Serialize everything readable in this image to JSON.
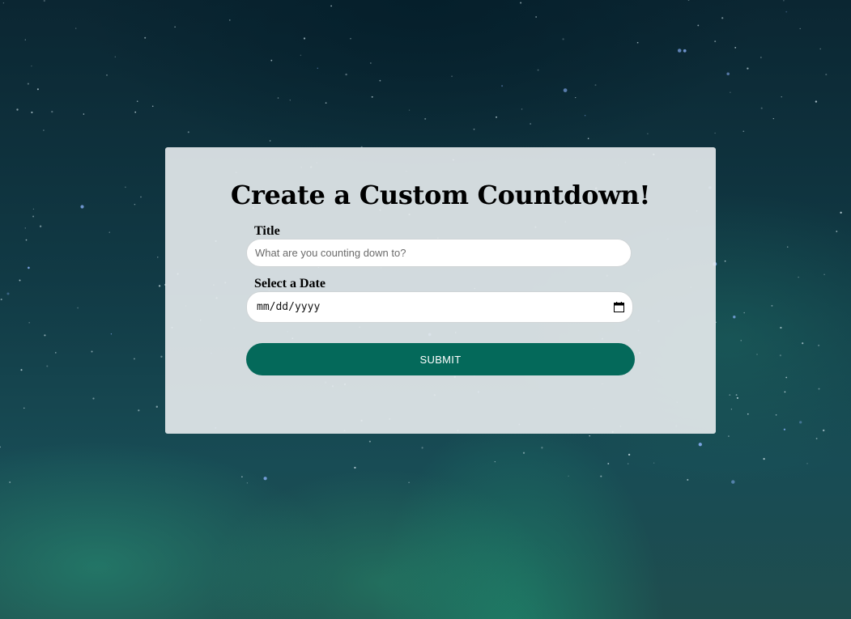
{
  "background": {
    "description_colors": {
      "sky_dark": "#0b2632",
      "aurora": "#1ea078"
    }
  },
  "form": {
    "title": "Create a Custom Countdown!",
    "title_field": {
      "label": "Title",
      "placeholder": "What are you counting down to?",
      "value": ""
    },
    "date_field": {
      "label": "Select a Date",
      "value": "mm/dd/yyyy",
      "icon": "calendar-icon"
    },
    "submit_label": "SUBMIT",
    "colors": {
      "card_bg": "#e8ecee",
      "button_bg": "#04695a",
      "button_text": "#ffffff"
    }
  }
}
